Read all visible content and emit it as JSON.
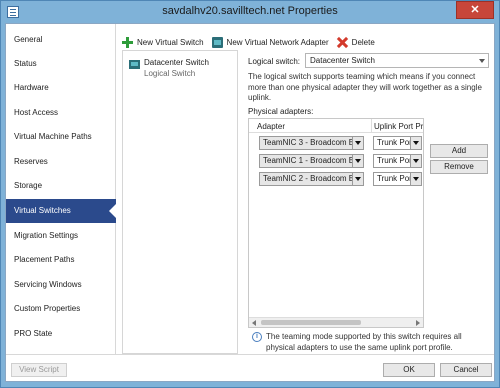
{
  "window": {
    "title": "savdalhv20.savilltech.net Properties",
    "close_glyph": "✕"
  },
  "nav": {
    "items": [
      {
        "label": "General"
      },
      {
        "label": "Status"
      },
      {
        "label": "Hardware"
      },
      {
        "label": "Host Access"
      },
      {
        "label": "Virtual Machine Paths"
      },
      {
        "label": "Reserves"
      },
      {
        "label": "Storage"
      },
      {
        "label": "Virtual Switches"
      },
      {
        "label": "Migration Settings"
      },
      {
        "label": "Placement Paths"
      },
      {
        "label": "Servicing Windows"
      },
      {
        "label": "Custom Properties"
      },
      {
        "label": "PRO State"
      }
    ],
    "active_index": 7
  },
  "toolbar": {
    "new_virtual_switch": "New Virtual Switch",
    "new_virtual_network_adapter": "New Virtual Network Adapter",
    "delete": "Delete"
  },
  "switch_list": {
    "items": [
      {
        "name": "Datacenter Switch",
        "type": "Logical Switch"
      }
    ]
  },
  "details": {
    "logical_switch_label": "Logical switch:",
    "logical_switch_value": "Datacenter Switch",
    "description": "The logical switch supports teaming which means if you connect more than one physical adapter they will work together as a single uplink.",
    "physical_adapters_label": "Physical adapters:",
    "columns": [
      "Adapter",
      "Uplink Port Prof"
    ],
    "rows": [
      {
        "adapter": "TeamNIC 3 - Broadcom B",
        "uplink": "Trunk Port"
      },
      {
        "adapter": "TeamNIC 1 - Broadcom B",
        "uplink": "Trunk Port"
      },
      {
        "adapter": "TeamNIC 2 - Broadcom B",
        "uplink": "Trunk Port"
      }
    ],
    "add_label": "Add",
    "remove_label": "Remove",
    "info_text": "The teaming mode supported by this switch requires all physical adapters to use the same uplink port profile."
  },
  "footer": {
    "view_script": "View Script",
    "ok": "OK",
    "cancel": "Cancel"
  }
}
